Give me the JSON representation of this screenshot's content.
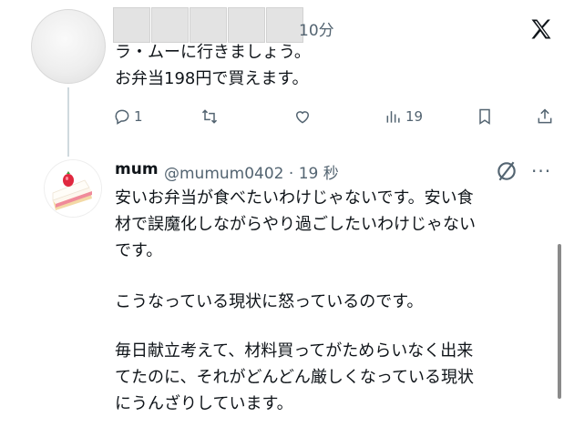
{
  "first_tweet": {
    "time": "10分",
    "text_line1": "ラ・ムーに行きましょう。",
    "text_line2": "お弁当198円で買えます。",
    "actions": {
      "replies": "1",
      "views": "19"
    },
    "logo_icon": "x-logo-icon"
  },
  "reply_tweet": {
    "display_name": "mum",
    "handle_time": "@mumum0402 · 19 秒",
    "lines": [
      "安いお弁当が食べたいわけじゃないです。安い食",
      "材で誤魔化しながらやり過ごしたいわけじゃない",
      "です。",
      "こうなっている現状に怒っているのです。",
      "毎日献立考えて、材料買ってがためらいなく出来",
      "てたのに、それがどんどん厳しくなっている現状",
      "にうんざりしています。"
    ]
  },
  "icons": {
    "reply": "reply-icon",
    "retweet": "retweet-icon",
    "like": "like-icon",
    "views": "views-icon",
    "bookmark": "bookmark-icon",
    "share": "share-icon",
    "grok": "grok-icon",
    "more": "more-icon"
  },
  "colors": {
    "muted": "#536471",
    "text": "#0f1419",
    "thread_line": "#cfd9de"
  }
}
